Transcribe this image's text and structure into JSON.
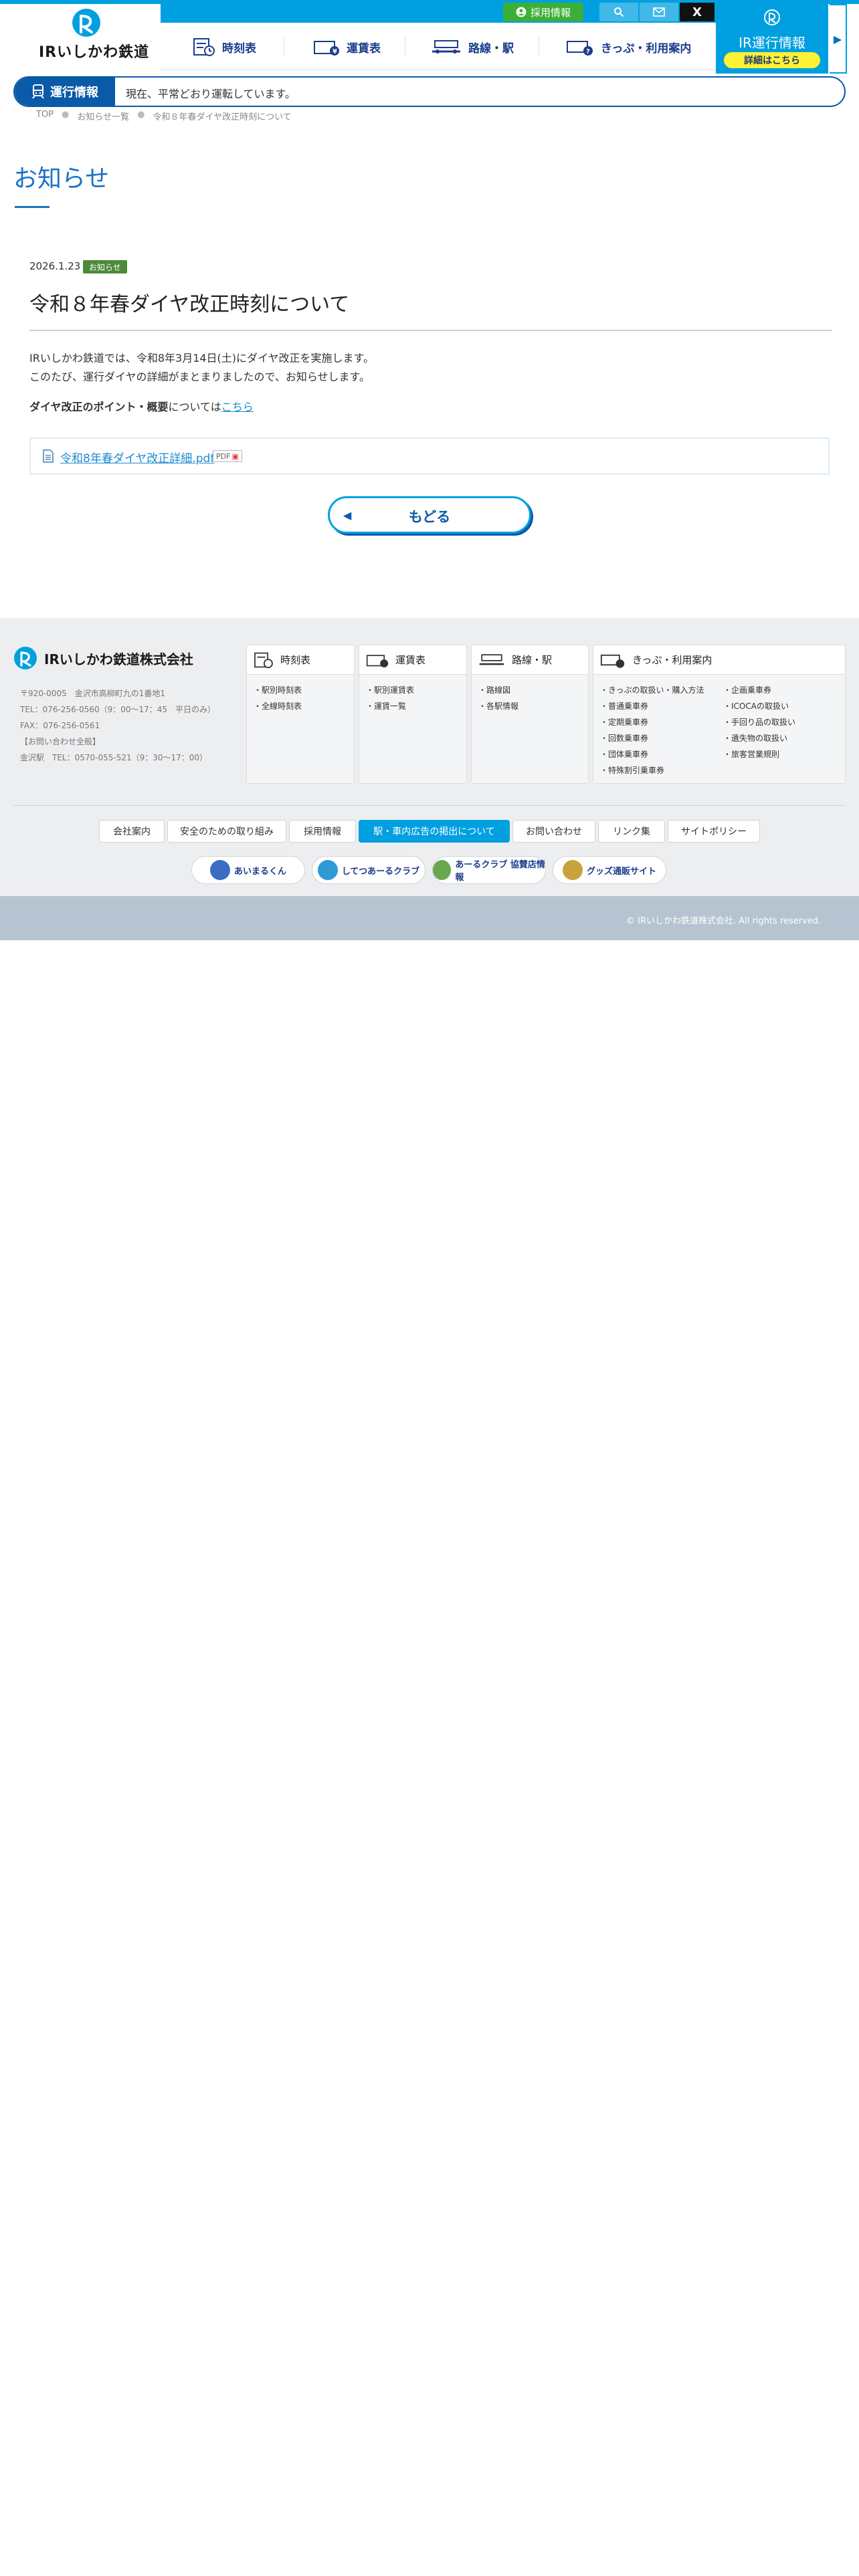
{
  "header": {
    "logo_text": "IRいしかわ鉄道",
    "recruit": "採用情報",
    "x_label": "X",
    "nav": [
      "時刻表",
      "運賃表",
      "路線・駅",
      "きっぷ・利用案内"
    ],
    "ir_info_title": "IR運行情報",
    "ir_info_pill": "詳細はこちら"
  },
  "status": {
    "label": "運行情報",
    "text": "現在、平常どおり運転しています。"
  },
  "breadcrumb": [
    "TOP",
    "お知らせ一覧",
    "令和８年春ダイヤ改正時刻について"
  ],
  "page_title": "お知らせ",
  "post": {
    "date": "2026.1.23",
    "category": "お知らせ",
    "title": "令和８年春ダイヤ改正時刻について",
    "line1": "IRいしかわ鉄道では、令和8年3月14日(土)にダイヤ改正を実施します。",
    "line2": "このたび、運行ダイヤの詳細がまとまりましたので、お知らせします。",
    "point_bold": "ダイヤ改正のポイント・概要",
    "point_rest": "については",
    "point_link": "こちら",
    "pdf_name": "令和8年春ダイヤ改正詳細.pdf",
    "pdf_badge": "PDF"
  },
  "back_button": "もどる",
  "footer": {
    "company": "IRいしかわ鉄道株式会社",
    "address": [
      "〒920-0005　金沢市高柳町九の1番地1",
      "TEL：076-256-0560（9：00〜17：45　平日のみ）",
      "FAX：076-256-0561",
      "【お問い合わせ全般】",
      "金沢駅　TEL：0570-055-521（9：30〜17：00）"
    ],
    "columns": [
      {
        "title": "時刻表",
        "items": [
          "駅別時刻表",
          "全線時刻表"
        ]
      },
      {
        "title": "運賃表",
        "items": [
          "駅別運賃表",
          "運賃一覧"
        ]
      },
      {
        "title": "路線・駅",
        "items": [
          "路線図",
          "各駅情報"
        ]
      },
      {
        "title": "きっぷ・利用案内",
        "items_left": [
          "きっぷの取扱い・購入方法",
          "普通乗車券",
          "定期乗車券",
          "回数乗車券",
          "団体乗車券",
          "特殊割引乗車券"
        ],
        "items_right": [
          "企画乗車券",
          "ICOCAの取扱い",
          "手回り品の取扱い",
          "遺失物の取扱い",
          "旅客営業規則"
        ]
      }
    ],
    "links": [
      "会社案内",
      "安全のための取り組み",
      "採用情報",
      "駅・車内広告の掲出について",
      "お問い合わせ",
      "リンク集",
      "サイトポリシー"
    ],
    "banners": [
      "あいまるくん",
      "してつあーるクラブ",
      "あーるクラブ 協賛店情報",
      "グッズ通販サイト"
    ],
    "copyright": "© IRいしかわ鉄道株式会社. All rights reserved."
  },
  "colors": {
    "brand_blue": "#00a0e0",
    "navy": "#0a5aa8",
    "recruit_green": "#3cb036",
    "badge_green": "#4d8a3a",
    "pill_yellow": "#fff133"
  }
}
